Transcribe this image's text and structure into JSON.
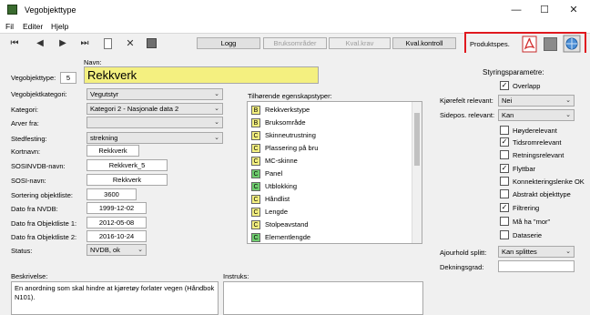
{
  "window": {
    "title": "Vegobjekttype",
    "minimize": "—",
    "maximize": "☐",
    "close": "✕"
  },
  "menu": [
    "Fil",
    "Editer",
    "Hjelp"
  ],
  "toolbar": {
    "first": "⏮",
    "prev": "◀",
    "next": "▶",
    "last": "⏭",
    "buttons": {
      "logg": "Logg",
      "bruksomrader": "Bruksområder",
      "kvalkrav": "Kval.krav",
      "kvalkontroll": "Kval.kontroll"
    },
    "produktspes_label": "Produktspes."
  },
  "form": {
    "navn_label": "Navn:",
    "navn_value": "Rekkverk",
    "vegobjekttype_label": "Vegobjekttype:",
    "vegobjekttype_value": "5",
    "vegobjektkategori_label": "Vegobjektkategori:",
    "vegobjektkategori_value": "Vegutstyr",
    "kategori_label": "Kategori:",
    "kategori_value": "Kategori 2 - Nasjonale data 2",
    "arver_fra_label": "Arver fra:",
    "arver_fra_value": "",
    "stedfesting_label": "Stedfesting:",
    "stedfesting_value": "strekning",
    "kortnavn_label": "Kortnavn:",
    "kortnavn_value": "Rekkverk",
    "sosinvdb_label": "SOSINVDB-navn:",
    "sosinvdb_value": "Rekkverk_5",
    "sosi_label": "SOSI-navn:",
    "sosi_value": "Rekkverk",
    "sortering_label": "Sortering objektliste:",
    "sortering_value": "3600",
    "dato_nvdb_label": "Dato fra NVDB:",
    "dato_nvdb_value": "1999-12-02",
    "dato_ol1_label": "Dato fra Objektliste 1:",
    "dato_ol1_value": "2012-05-08",
    "dato_ol2_label": "Dato fra Objektliste 2:",
    "dato_ol2_value": "2016-10-24",
    "status_label": "Status:",
    "status_value": "NVDB, ok",
    "beskrivelse_label": "Beskrivelse:",
    "beskrivelse_value": "En anordning som skal hindre at kjøretøy forlater vegen (Håndbok N101).",
    "instruks_label": "Instruks:",
    "instruks_value": ""
  },
  "egenskapstyper": {
    "label": "Tilhørende egenskapstyper:",
    "items": [
      {
        "badge": "B",
        "color": "#f4f080",
        "name": "Rekkverkstype"
      },
      {
        "badge": "B",
        "color": "#f4f080",
        "name": "Bruksområde"
      },
      {
        "badge": "C",
        "color": "#f4f080",
        "name": "Skinneutrustning"
      },
      {
        "badge": "C",
        "color": "#f4f080",
        "name": "Plassering på bru"
      },
      {
        "badge": "C",
        "color": "#f4f080",
        "name": "MC-skinne"
      },
      {
        "badge": "C",
        "color": "#6fce6f",
        "name": "Panel"
      },
      {
        "badge": "C",
        "color": "#6fce6f",
        "name": "Utblokking"
      },
      {
        "badge": "C",
        "color": "#f4f080",
        "name": "Håndlist"
      },
      {
        "badge": "C",
        "color": "#f4f080",
        "name": "Lengde"
      },
      {
        "badge": "C",
        "color": "#f4f080",
        "name": "Stolpeavstand"
      },
      {
        "badge": "C",
        "color": "#6fce6f",
        "name": "Elementlengde"
      }
    ]
  },
  "styring": {
    "title": "Styringsparametre:",
    "overlapp": {
      "label": "Overlapp",
      "checked": true
    },
    "kjorefelt_label": "Kjørefelt relevant:",
    "kjorefelt_value": "Nei",
    "sidepos_label": "Sidepos. relevant:",
    "sidepos_value": "Kan",
    "checks": [
      {
        "label": "Høyderelevant",
        "checked": false
      },
      {
        "label": "Tidsromrelevant",
        "checked": true
      },
      {
        "label": "Retningsrelevant",
        "checked": false
      },
      {
        "label": "Flyttbar",
        "checked": true
      },
      {
        "label": "Konnekteringslenke OK",
        "checked": false
      },
      {
        "label": "Abstrakt objekttype",
        "checked": false
      },
      {
        "label": "Filtrering",
        "checked": true
      },
      {
        "label": "Må ha \"mor\"",
        "checked": false
      },
      {
        "label": "Dataserie",
        "checked": false
      }
    ],
    "ajourhold_label": "Ajourhold splitt:",
    "ajourhold_value": "Kan splittes",
    "dekningsgrad_label": "Dekningsgrad:",
    "dekningsgrad_value": ""
  },
  "colors": {
    "accent_red": "#e0191f",
    "name_yellow": "#f4f080"
  }
}
